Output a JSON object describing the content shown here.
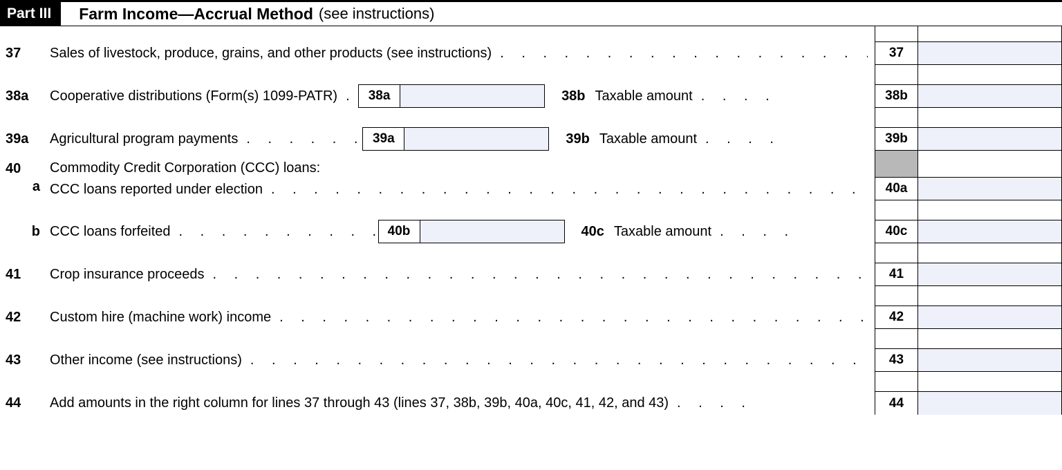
{
  "header": {
    "part": "Part III",
    "title": "Farm Income—Accrual Method",
    "sub": "(see instructions)"
  },
  "lines": {
    "l37": {
      "num": "37",
      "text": "Sales of livestock, produce, grains, and other products (see instructions)",
      "box": "37"
    },
    "l38a": {
      "num": "38a",
      "text": "Cooperative distributions (Form(s) 1099-PATR)",
      "mid": "38a",
      "sub_num": "38b",
      "sub_text": "Taxable amount",
      "box": "38b"
    },
    "l39a": {
      "num": "39a",
      "text": "Agricultural program payments",
      "mid": "39a",
      "sub_num": "39b",
      "sub_text": "Taxable amount",
      "box": "39b"
    },
    "l40": {
      "num": "40",
      "text": "Commodity Credit Corporation (CCC) loans:"
    },
    "l40a": {
      "num": "a",
      "text": "CCC loans reported under election",
      "box": "40a"
    },
    "l40b": {
      "num": "b",
      "text": "CCC loans forfeited",
      "mid": "40b",
      "sub_num": "40c",
      "sub_text": "Taxable amount",
      "box": "40c"
    },
    "l41": {
      "num": "41",
      "text": "Crop insurance proceeds",
      "box": "41"
    },
    "l42": {
      "num": "42",
      "text": "Custom hire (machine work) income",
      "box": "42"
    },
    "l43": {
      "num": "43",
      "text": "Other income (see instructions)",
      "box": "43"
    },
    "l44": {
      "num": "44",
      "text": "Add amounts in the right column for lines 37 through 43 (lines 37, 38b, 39b, 40a, 40c, 41, 42, and 43)",
      "box": "44"
    }
  },
  "dots": ".   .   .   .   .   .   .   .   .   .   .   .   .   .   .   .   .   .   .   .   .   .   .   .   .   .   .   .   .   .   .   .   .   .   .   .   .   .   .   .",
  "dots_short": ".   .   .   ."
}
